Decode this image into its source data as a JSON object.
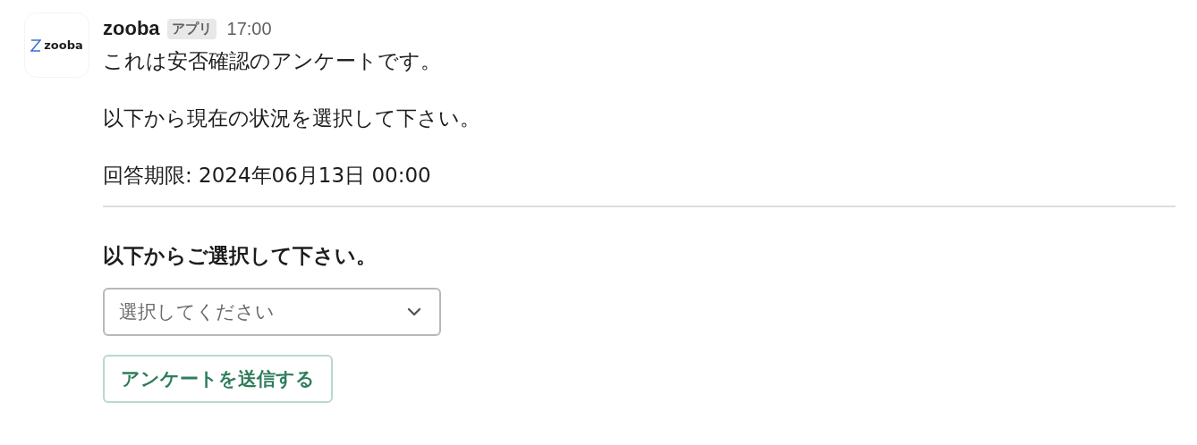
{
  "message": {
    "avatar_logo_text": "zooba",
    "sender": "zooba",
    "badge": "アプリ",
    "time": "17:00",
    "paragraphs": [
      "これは安否確認のアンケートです。",
      "以下から現在の状況を選択して下さい。",
      "回答期限: 2024年06月13日 00:00"
    ]
  },
  "form": {
    "heading": "以下からご選択して下さい。",
    "select": {
      "placeholder": "選択してください"
    },
    "submit_button": "アンケートを送信する"
  }
}
